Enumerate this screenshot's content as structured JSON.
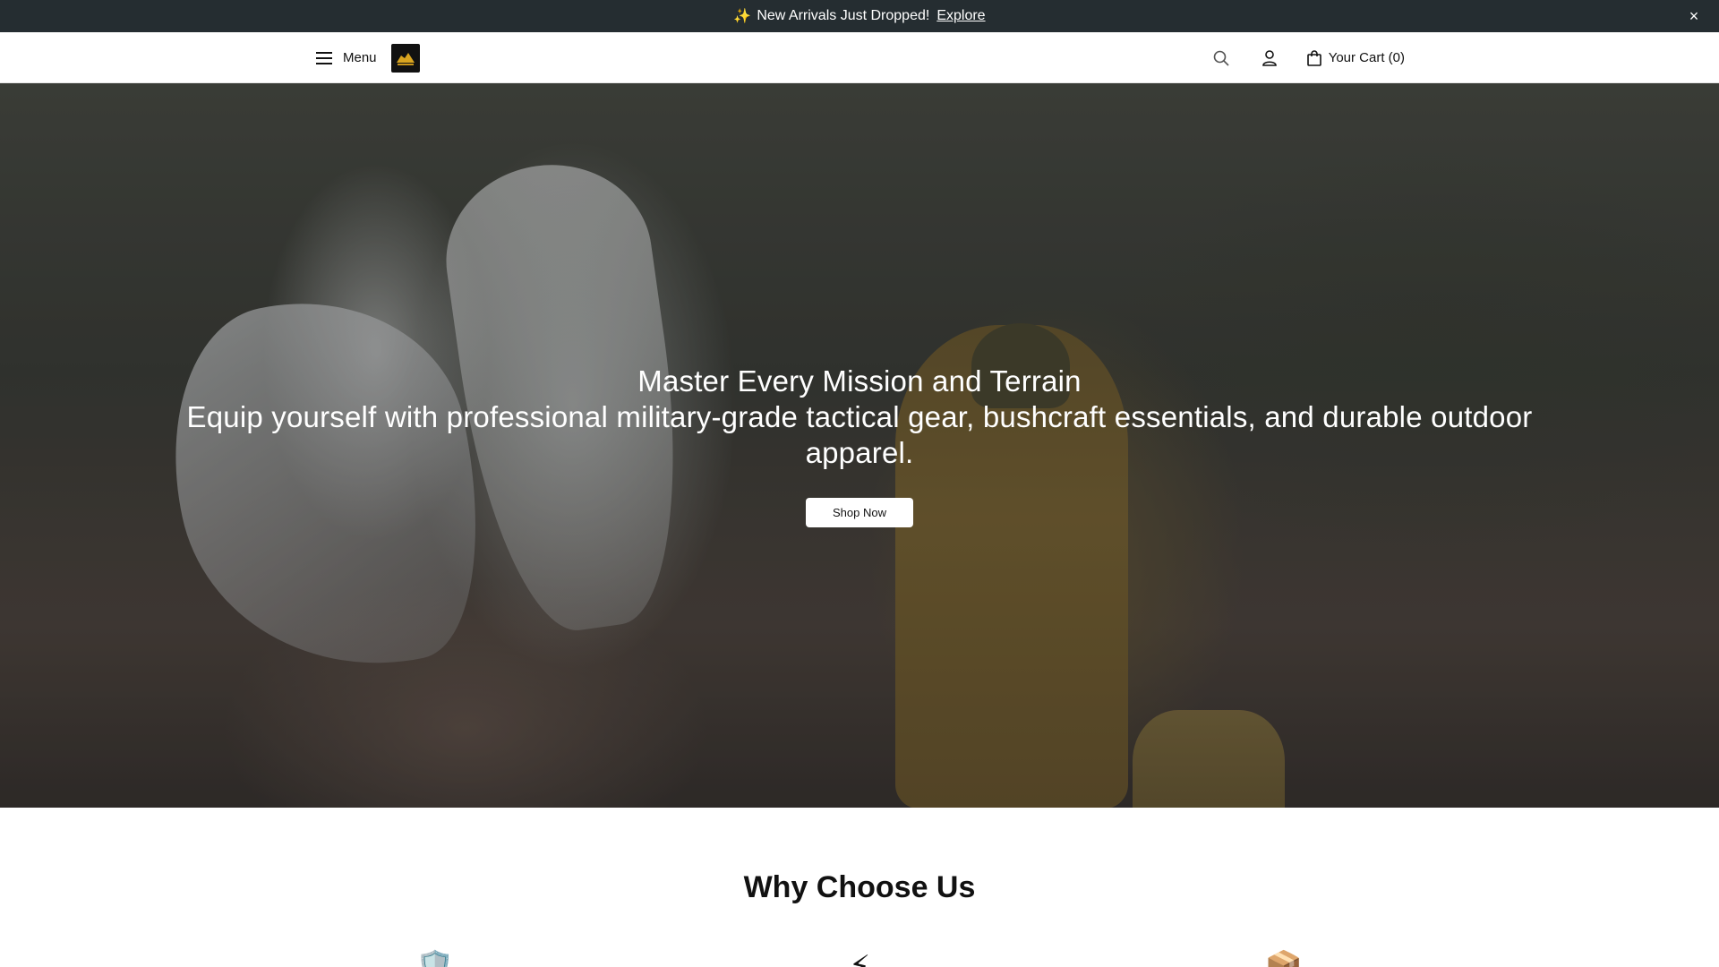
{
  "announcement": {
    "text": "New Arrivals Just Dropped!",
    "link_label": "Explore",
    "sparkle_icon": "✨",
    "close_label": "×"
  },
  "header": {
    "menu_label": "Menu",
    "logo_icon": "logo",
    "cart_label": "Your Cart (0)"
  },
  "hero": {
    "title": "Master Every Mission and Terrain",
    "subtitle": "Equip yourself with professional military-grade tactical gear, bushcraft essentials, and durable outdoor apparel.",
    "cta_label": "Shop Now"
  },
  "why": {
    "title": "Why Choose Us",
    "icons": [
      {
        "name": "shield-icon",
        "glyph": "🛡️"
      },
      {
        "name": "lightning-icon",
        "glyph": "⚡"
      },
      {
        "name": "package-icon",
        "glyph": "📦"
      }
    ]
  },
  "colors": {
    "announcement_bg": "#252d31",
    "header_bg": "#ffffff",
    "button_bg": "#ffffff"
  }
}
